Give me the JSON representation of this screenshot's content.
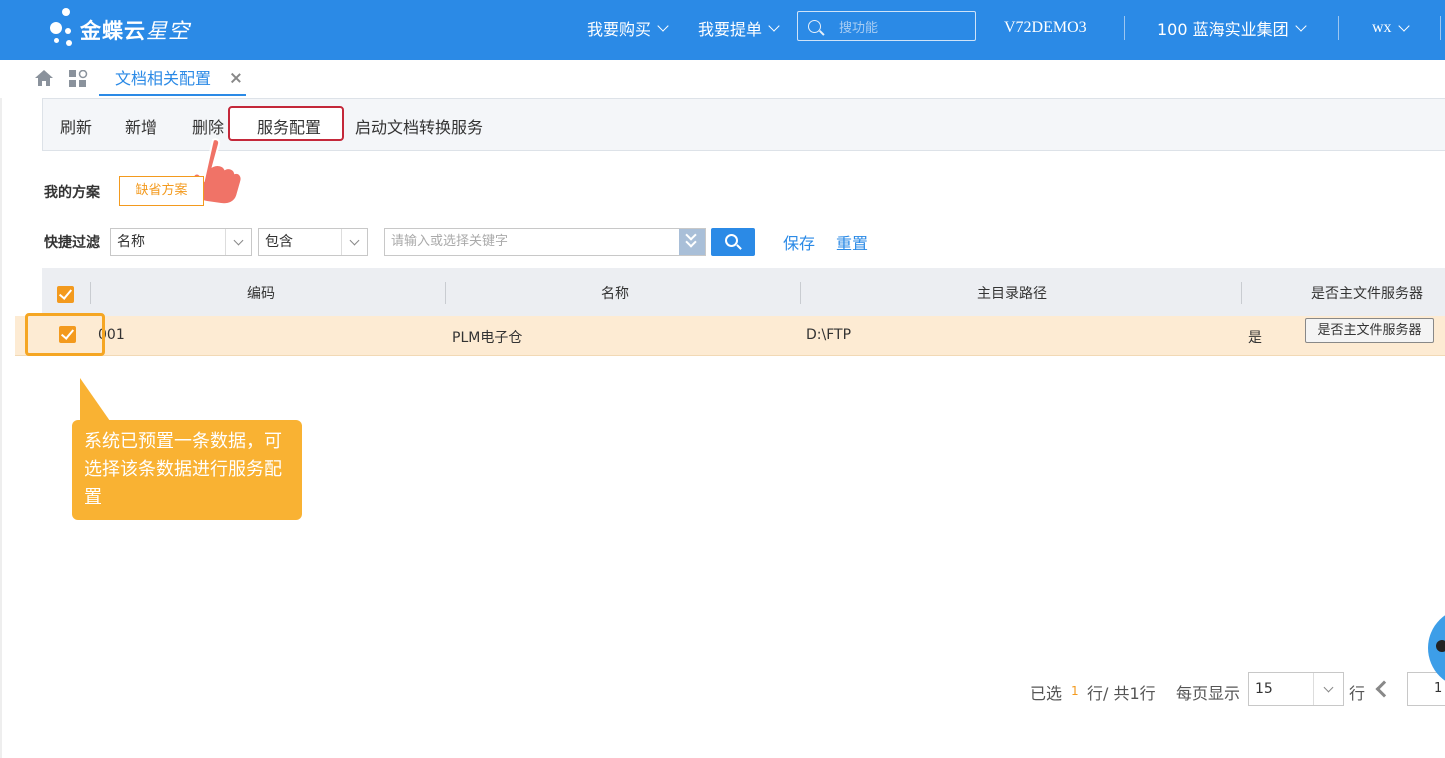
{
  "header": {
    "logo_brand": "金蝶云",
    "logo_product": "星空",
    "menu_buy": "我要购买",
    "menu_submit": "我要提单",
    "search_placeholder": "搜功能",
    "datacenter": "V72DEMO3",
    "org": "100 蓝海实业集团",
    "user": "wx"
  },
  "tabs": [
    {
      "label": "文档相关配置",
      "active": true
    }
  ],
  "toolbar": {
    "refresh": "刷新",
    "add": "新增",
    "delete": "删除",
    "service_config": "服务配置",
    "start_conversion": "启动文档转换服务"
  },
  "plan": {
    "label": "我的方案",
    "default_plan": "缺省方案"
  },
  "quick_filter": {
    "label": "快捷过滤",
    "field": "名称",
    "operator": "包含",
    "keyword_placeholder": "请输入或选择关键字",
    "save": "保存",
    "reset": "重置"
  },
  "grid": {
    "columns": [
      "编码",
      "名称",
      "主目录路径",
      "是否主文件服务器"
    ],
    "rows": [
      {
        "code": "001",
        "name": "PLM电子仓",
        "path": "D:\\FTP",
        "is_main": "是",
        "action": "是否主文件服务器",
        "selected": true
      }
    ]
  },
  "callout": {
    "text": "系统已预置一条数据，可选择该条数据进行服务配置"
  },
  "pager": {
    "selected_prefix": "已选",
    "selected_count": "1",
    "selected_suffix": "行/ 共1行",
    "page_size_label": "每页显示",
    "page_size": "15",
    "rows_unit": "行",
    "current_page": "1"
  },
  "colors": {
    "primary": "#2b8ae6",
    "accent_orange": "#f39a1e",
    "highlight_red": "#c4283a",
    "callout": "#f9b233",
    "row_selected": "#fdebd3"
  }
}
